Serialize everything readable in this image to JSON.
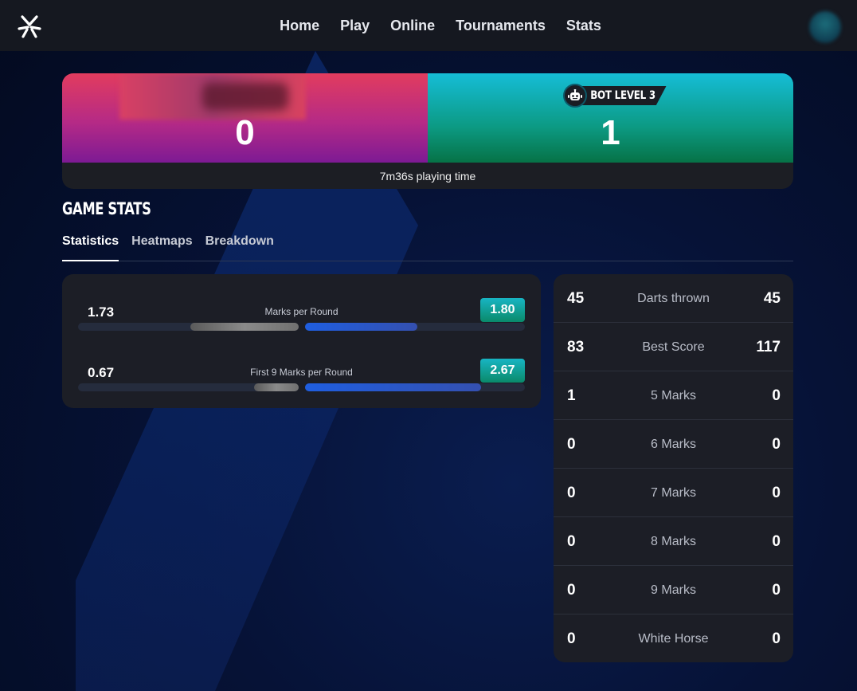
{
  "nav": {
    "items": [
      "Home",
      "Play",
      "Online",
      "Tournaments",
      "Stats"
    ]
  },
  "colors": {
    "player_gradient_top": "#e23c5e",
    "player_gradient_bottom": "#7d1a94",
    "bot_gradient_top": "#15bdd7",
    "bot_gradient_bottom": "#067246",
    "accent_blue": "#1f5ee0",
    "badge_teal": "#18b5c3"
  },
  "scoreboard": {
    "player_score": "0",
    "bot_label": "BOT LEVEL 3",
    "bot_score": "1",
    "playing_time": "7m36s playing time"
  },
  "section_title": "GAME STATS",
  "tabs": [
    "Statistics",
    "Heatmaps",
    "Breakdown"
  ],
  "metrics": [
    {
      "label": "Marks per Round",
      "left": "1.73",
      "right": "1.80",
      "left_value": 1.73,
      "right_value": 1.8
    },
    {
      "label": "First 9 Marks per Round",
      "left": "0.67",
      "right": "2.67",
      "left_value": 0.67,
      "right_value": 2.67
    }
  ],
  "table": [
    {
      "label": "Darts thrown",
      "left": "45",
      "right": "45"
    },
    {
      "label": "Best Score",
      "left": "83",
      "right": "117"
    },
    {
      "label": "5 Marks",
      "left": "1",
      "right": "0"
    },
    {
      "label": "6 Marks",
      "left": "0",
      "right": "0"
    },
    {
      "label": "7 Marks",
      "left": "0",
      "right": "0"
    },
    {
      "label": "8 Marks",
      "left": "0",
      "right": "0"
    },
    {
      "label": "9 Marks",
      "left": "0",
      "right": "0"
    },
    {
      "label": "White Horse",
      "left": "0",
      "right": "0"
    }
  ]
}
